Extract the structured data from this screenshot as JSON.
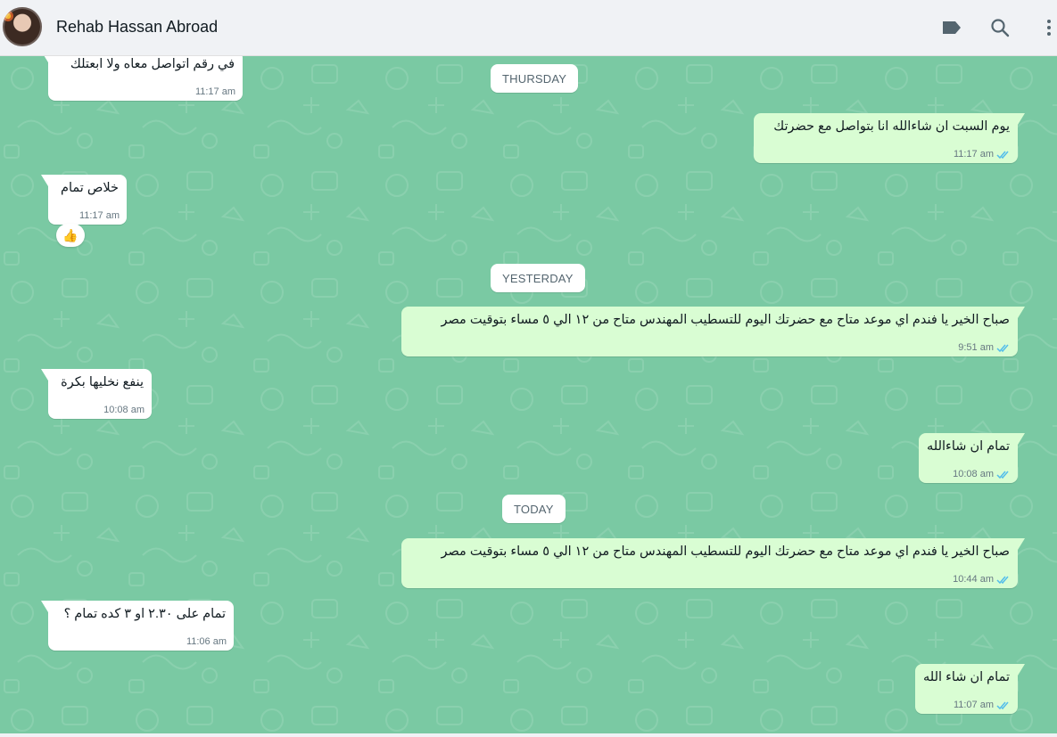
{
  "header": {
    "contact_name": "Rehab Hassan Abroad",
    "icons": [
      "label-icon",
      "search-icon",
      "menu-icon"
    ]
  },
  "colors": {
    "chat_bg": "#7ac9a3",
    "incoming_bubble": "#ffffff",
    "outgoing_bubble": "#d9fdd3",
    "read_ticks": "#53bdeb"
  },
  "dividers": [
    "THURSDAY",
    "YESTERDAY",
    "TODAY"
  ],
  "messages": [
    {
      "dir": "in",
      "text": "في رقم اتواصل معاه ولا ابعتلك",
      "time": "11:17 am"
    },
    {
      "dir": "out",
      "text": "يوم السبت ان شاءالله انا بتواصل مع حضرتك",
      "time": "11:17 am",
      "status": "read"
    },
    {
      "dir": "in",
      "text": "خلاص تمام",
      "time": "11:17 am",
      "reaction": "👍"
    },
    {
      "dir": "out",
      "text": "صباح الخير يا فندم اي موعد متاح مع حضرتك اليوم للتسطيب المهندس متاح من ١٢ الي ٥ مساء بتوقيت مصر",
      "time": "9:51 am",
      "status": "read"
    },
    {
      "dir": "in",
      "text": "ينفع نخليها بكرة",
      "time": "10:08 am"
    },
    {
      "dir": "out",
      "text": "تمام ان شاءالله",
      "time": "10:08 am",
      "status": "read"
    },
    {
      "dir": "out",
      "text": "صباح الخير يا فندم اي موعد متاح مع حضرتك اليوم للتسطيب المهندس متاح من ١٢ الي ٥ مساء بتوقيت مصر",
      "time": "10:44 am",
      "status": "read"
    },
    {
      "dir": "in",
      "text": "تمام على ٢.٣٠ او ٣ كده تمام ؟",
      "time": "11:06 am"
    },
    {
      "dir": "out",
      "text": "تمام ان شاء الله",
      "time": "11:07 am",
      "status": "read"
    }
  ]
}
